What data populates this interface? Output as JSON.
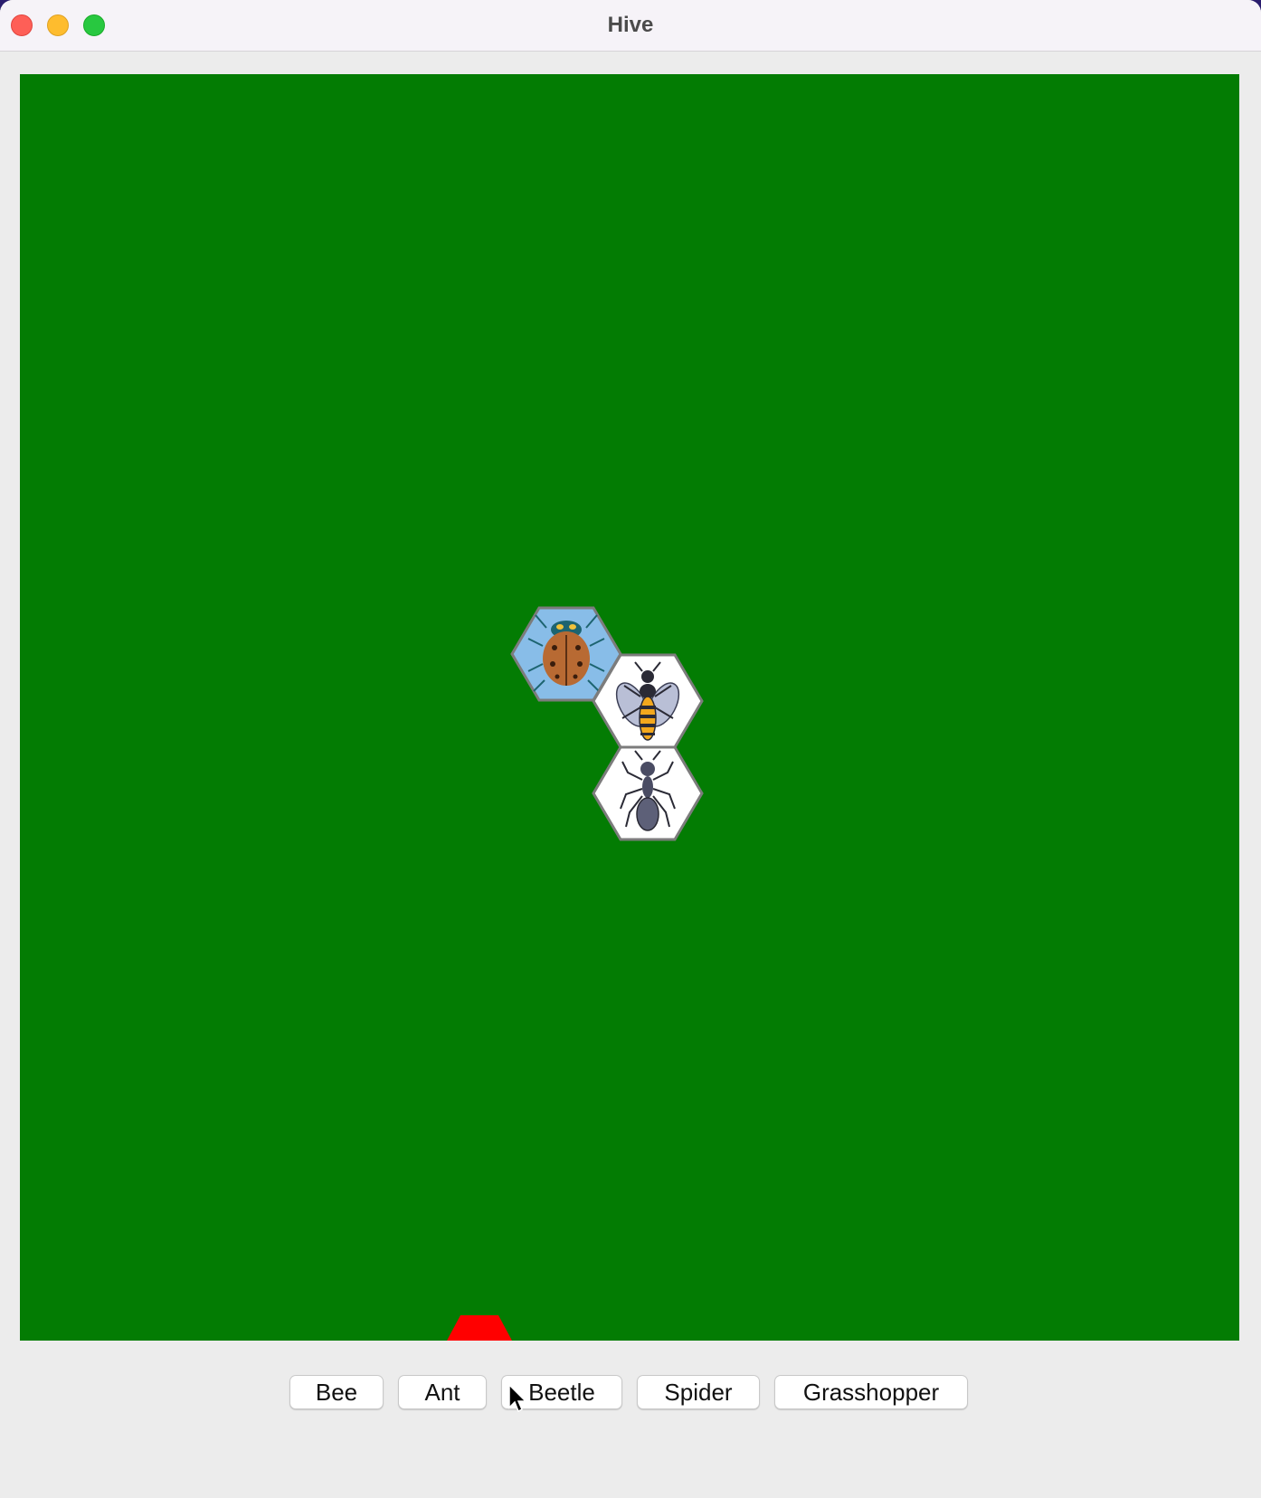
{
  "window": {
    "title": "Hive"
  },
  "board": {
    "background": "#037c03",
    "tiles": [
      {
        "piece": "ladybug",
        "highlighted": true,
        "fill": "#88bde8"
      },
      {
        "piece": "bee",
        "highlighted": false,
        "fill": "#ffffff"
      },
      {
        "piece": "ant",
        "highlighted": false,
        "fill": "#ffffff"
      }
    ],
    "marker_color": "#ff0000"
  },
  "buttons": [
    {
      "label": "Bee"
    },
    {
      "label": "Ant"
    },
    {
      "label": "Beetle"
    },
    {
      "label": "Spider"
    },
    {
      "label": "Grasshopper"
    }
  ]
}
